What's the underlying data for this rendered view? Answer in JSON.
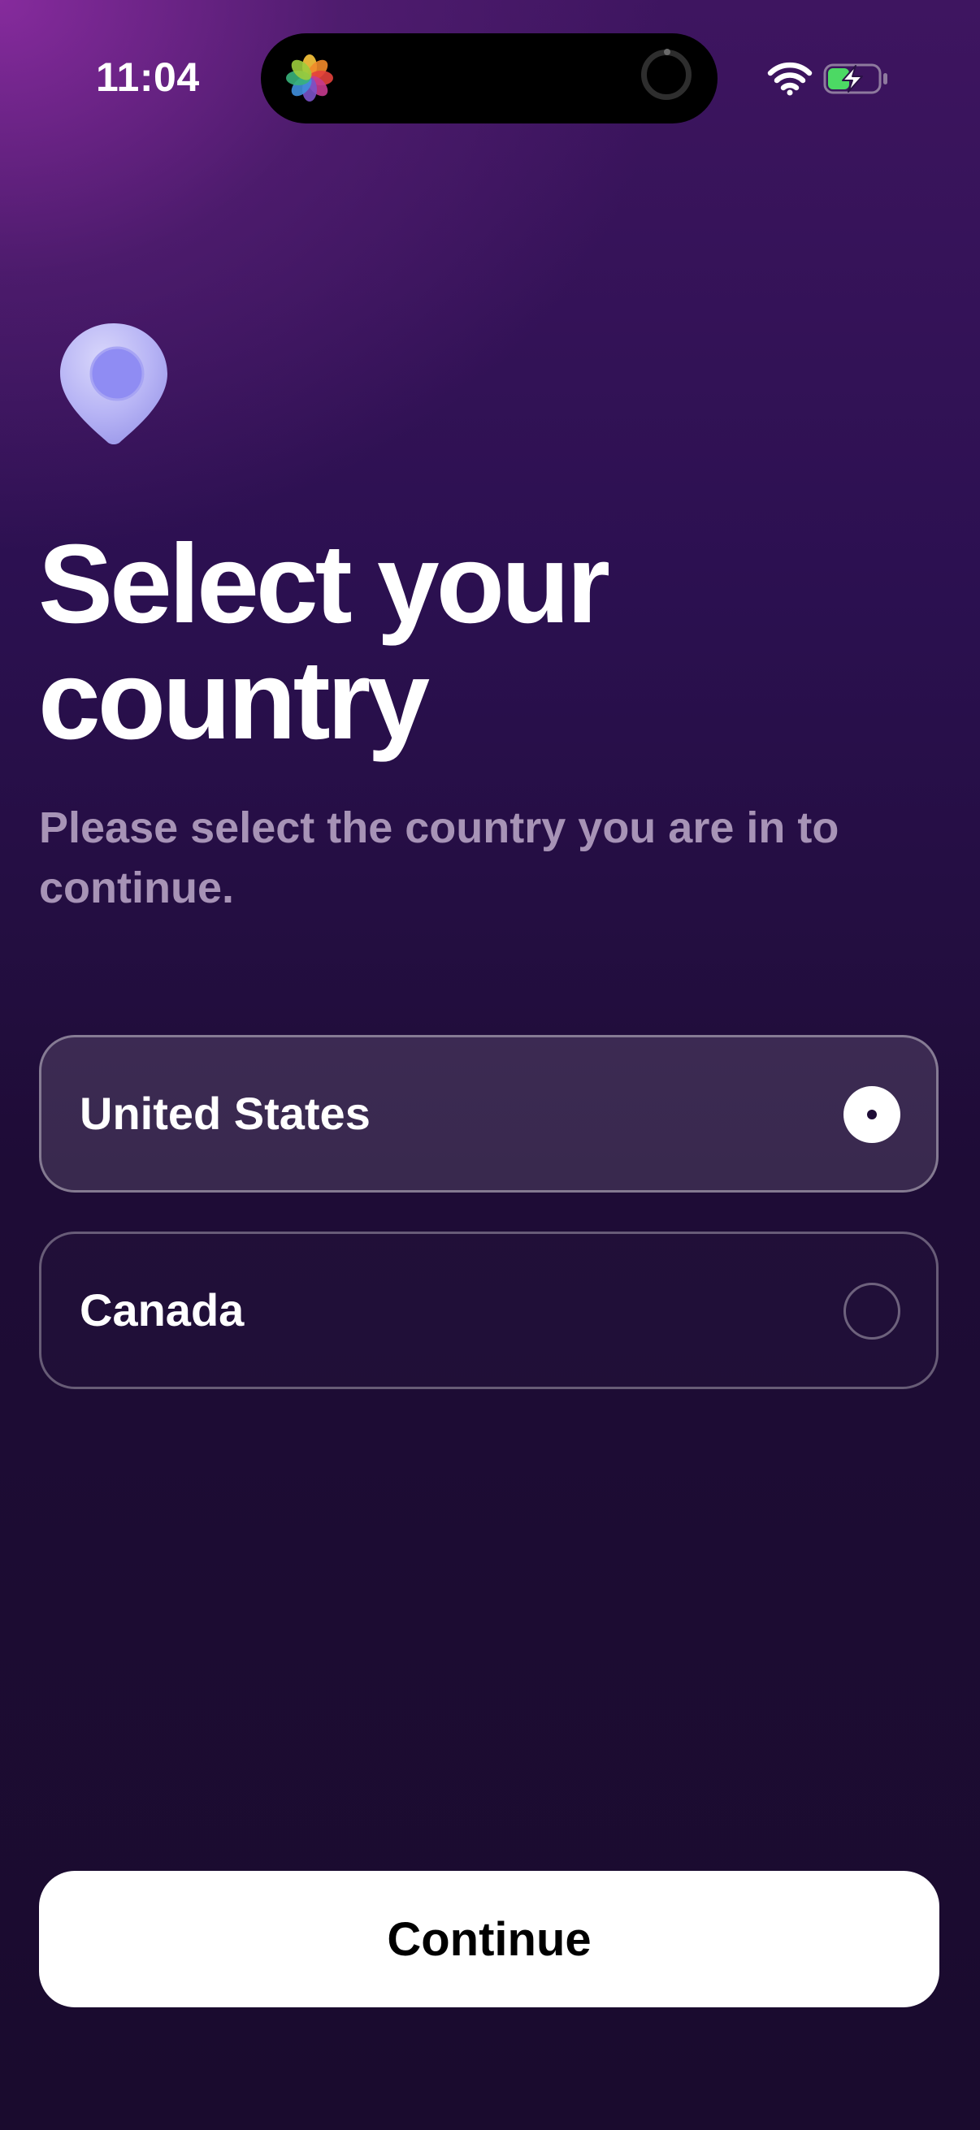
{
  "status_bar": {
    "time": "11:04"
  },
  "icons": {
    "status_wifi": "wifi-icon",
    "status_battery": "battery-charging-icon",
    "dynamic_island_app": "photos-icon",
    "hero": "location-pin-icon"
  },
  "header": {
    "title_line1": "Select your",
    "title_line2": "country",
    "subtitle": "Please select the country you are in to continue."
  },
  "countries": {
    "options": [
      {
        "label": "United States",
        "selected": true
      },
      {
        "label": "Canada",
        "selected": false
      }
    ]
  },
  "footer": {
    "continue_label": "Continue"
  },
  "colors": {
    "background_top": "#3e1560",
    "background_bottom": "#1a0b2e",
    "subtitle_text": "#a793b6",
    "pin": "#b4b2f6",
    "pin_center": "#8f8cf3",
    "button_background": "#ffffff"
  }
}
